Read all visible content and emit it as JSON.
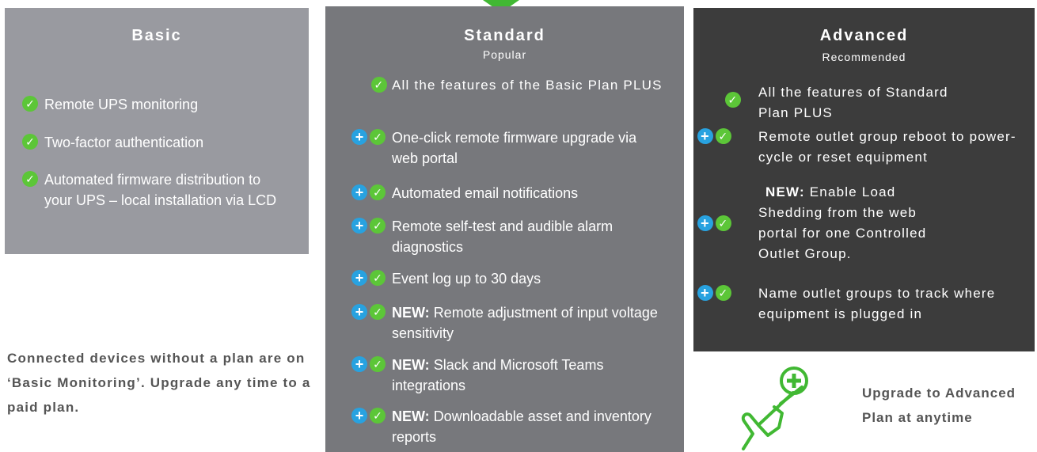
{
  "plans": {
    "basic": {
      "title": "Basic",
      "features": [
        {
          "text": "Remote  UPS monitoring",
          "plus": false
        },
        {
          "text": "Two-factor authentication",
          "plus": false
        },
        {
          "text": "Automated firmware distribution to your UPS – local installation via LCD",
          "plus": false
        }
      ]
    },
    "standard": {
      "title": "Standard",
      "subtitle": "Popular",
      "features": [
        {
          "text": "All the features of the Basic Plan PLUS",
          "plus": false
        },
        {
          "text": "One-click remote firmware upgrade via web portal",
          "plus": true
        },
        {
          "text": "Automated email notifications",
          "plus": true
        },
        {
          "text": "Remote self-test and audible alarm diagnostics",
          "plus": true
        },
        {
          "text": "Event log up to 30 days",
          "plus": true
        },
        {
          "new_label": "NEW:",
          "text": "Remote adjustment of input voltage sensitivity",
          "plus": true
        },
        {
          "new_label": "NEW:",
          "text": "Slack and Microsoft Teams integrations",
          "plus": true
        },
        {
          "new_label": "NEW:",
          "text": "Downloadable asset and inventory reports",
          "plus": true
        }
      ]
    },
    "advanced": {
      "title": "Advanced",
      "subtitle": "Recommended",
      "features": [
        {
          "text": "All the features of Standard Plan PLUS",
          "plus": false
        },
        {
          "text": "Remote outlet group reboot to power- cycle or reset equipment",
          "plus": true
        },
        {
          "new_label": "NEW:",
          "text": "Enable Load Shedding from the web portal for one Controlled Outlet Group.",
          "plus": true
        },
        {
          "text": "Name outlet groups to track where  equipment is plugged in",
          "plus": true
        }
      ]
    }
  },
  "note": "Connected devices without a plan are on ‘Basic Monitoring’. Upgrade any time to a paid plan.",
  "upgrade": {
    "title": "Upgrade to Advanced",
    "sub": "Plan at anytime",
    "icon": "hand-tap-plus-icon"
  },
  "colors": {
    "basic_bg": "#999aa0",
    "standard_bg": "#77787c",
    "advanced_bg": "#3c3c3c",
    "check": "#5cc638",
    "plus": "#28a2e0",
    "accent": "#41b833"
  }
}
